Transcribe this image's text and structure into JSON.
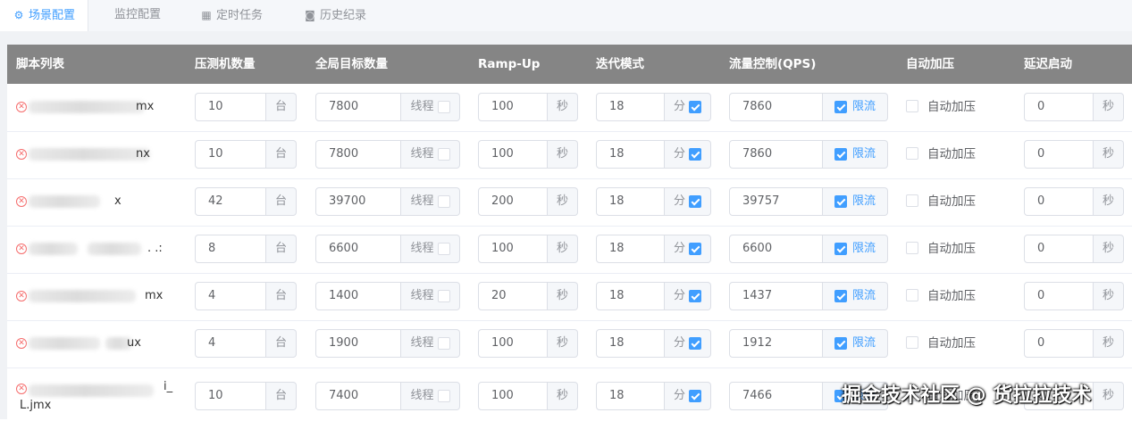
{
  "tabs": [
    {
      "label": "场景配置",
      "icon": "gear-icon",
      "active": true
    },
    {
      "label": "监控配置",
      "icon": "",
      "active": false
    },
    {
      "label": "定时任务",
      "icon": "calendar-icon",
      "active": false
    },
    {
      "label": "历史纪录",
      "icon": "camera-icon",
      "active": false
    }
  ],
  "columns": {
    "script": "脚本列表",
    "machines": "压测机数量",
    "target": "全局目标数量",
    "rampup": "Ramp-Up",
    "iter": "迭代模式",
    "qps": "流量控制(QPS)",
    "auto": "自动加压",
    "delay": "延迟启动"
  },
  "units": {
    "machine": "台",
    "thread": "线程",
    "sec": "秒",
    "min": "分",
    "limit": "限流",
    "auto": "自动加压"
  },
  "rows": [
    {
      "script": "mx",
      "machines": "10",
      "target": "7800",
      "rampup": "100",
      "iter": "18",
      "qps": "7860",
      "delay": "0"
    },
    {
      "script": "nx",
      "machines": "10",
      "target": "7800",
      "rampup": "100",
      "iter": "18",
      "qps": "7860",
      "delay": "0"
    },
    {
      "script": "x",
      "machines": "42",
      "target": "39700",
      "rampup": "200",
      "iter": "18",
      "qps": "39757",
      "delay": "0"
    },
    {
      "script": ". .:",
      "machines": "8",
      "target": "6600",
      "rampup": "100",
      "iter": "18",
      "qps": "6600",
      "delay": "0"
    },
    {
      "script": "mx",
      "machines": "4",
      "target": "1400",
      "rampup": "20",
      "iter": "18",
      "qps": "1437",
      "delay": "0"
    },
    {
      "script": "ux",
      "machines": "4",
      "target": "1900",
      "rampup": "100",
      "iter": "18",
      "qps": "1912",
      "delay": "0"
    },
    {
      "script": "i_",
      "script_line2": "L.jmx",
      "machines": "10",
      "target": "7400",
      "rampup": "100",
      "iter": "18",
      "qps": "7466",
      "delay": "0"
    }
  ],
  "watermark": "掘金技术社区 @ 货拉拉技术",
  "colors": {
    "accent": "#409eff",
    "header_bg": "#858585",
    "danger": "#f56c6c"
  }
}
